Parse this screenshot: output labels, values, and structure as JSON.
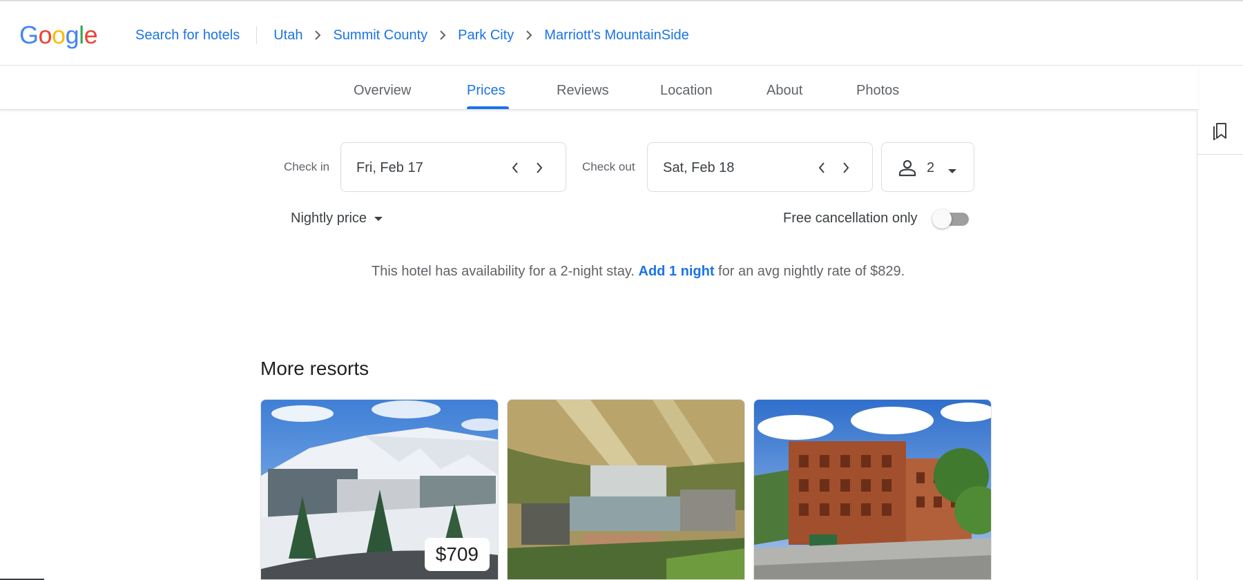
{
  "header": {
    "logo_letters": [
      {
        "ch": "G",
        "color": "#4285F4"
      },
      {
        "ch": "o",
        "color": "#EA4335"
      },
      {
        "ch": "o",
        "color": "#FBBC05"
      },
      {
        "ch": "g",
        "color": "#4285F4"
      },
      {
        "ch": "l",
        "color": "#34A853"
      },
      {
        "ch": "e",
        "color": "#EA4335"
      }
    ],
    "search_link": "Search for hotels",
    "breadcrumbs": [
      "Utah",
      "Summit County",
      "Park City",
      "Marriott's MountainSide"
    ]
  },
  "tabs": [
    "Overview",
    "Prices",
    "Reviews",
    "Location",
    "About",
    "Photos"
  ],
  "active_tab": "Prices",
  "icons": {
    "saved": "bookmarks-icon",
    "person": "person-icon",
    "chevron_left": "chevron-left-icon",
    "chevron_right": "chevron-right-icon",
    "dropdown": "arrow-drop-down-icon"
  },
  "booking": {
    "check_in_label": "Check in",
    "check_in_value": "Fri, Feb 17",
    "check_out_label": "Check out",
    "check_out_value": "Sat, Feb 18",
    "guests": "2",
    "price_mode": "Nightly price",
    "free_cancellation_label": "Free cancellation only",
    "free_cancellation_on": false
  },
  "availability": {
    "text_before": "This hotel has availability for a 2-night stay.",
    "link": "Add 1 night",
    "text_after": "for an avg nightly rate of $829."
  },
  "more_resorts": {
    "title": "More resorts",
    "cards": [
      {
        "image": "snowy-mountain-resort-photo",
        "price": "$709"
      },
      {
        "image": "autumn-mountain-village-photo",
        "price": ""
      },
      {
        "image": "brick-hotel-building-photo",
        "price": ""
      }
    ]
  },
  "colors": {
    "link_blue": "#1a73e8",
    "text": "#3c4043",
    "secondary_text": "#5f6368",
    "border": "#dadce0"
  }
}
